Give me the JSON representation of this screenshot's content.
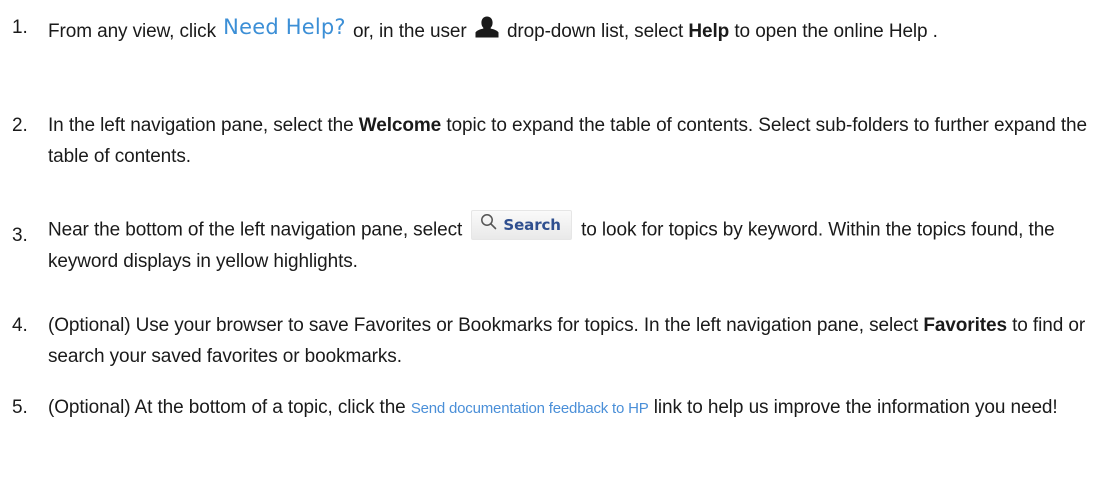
{
  "colors": {
    "text": "#1a1a1a",
    "link": "#4a8fd8",
    "need_help": "#3c8fd6",
    "search_label": "#2f4f8f"
  },
  "steps": [
    {
      "number": "1.",
      "t1": "From any view, click",
      "need_help": "Need Help?",
      "t2": "or, in the user",
      "user_icon": "user-icon",
      "t3": "drop-down list, select",
      "help_bold": "Help",
      "t4": "to open the online Help ."
    },
    {
      "number": "2.",
      "t1": "In the left navigation pane, select the",
      "welcome_bold": "Welcome",
      "t2": "topic to expand the table of contents. Select sub-folders to further expand the table of contents."
    },
    {
      "number": "3.",
      "t1": "Near the bottom of the left navigation pane, select",
      "search_icon": "search-icon",
      "search_label": "Search",
      "t2": "to look for topics by keyword. Within the topics found, the keyword displays in yellow highlights."
    },
    {
      "number": "4.",
      "t1": "(Optional) Use your browser to save Favorites or Bookmarks for topics. In the left navigation pane, select",
      "favorites_bold": "Favorites",
      "t2": "to find or search your saved favorites or bookmarks."
    },
    {
      "number": "5.",
      "t1": "(Optional) At the bottom of a topic, click the",
      "feedback_link": "Send documentation feedback to HP",
      "t2": "link to help us improve the information you need!"
    }
  ]
}
